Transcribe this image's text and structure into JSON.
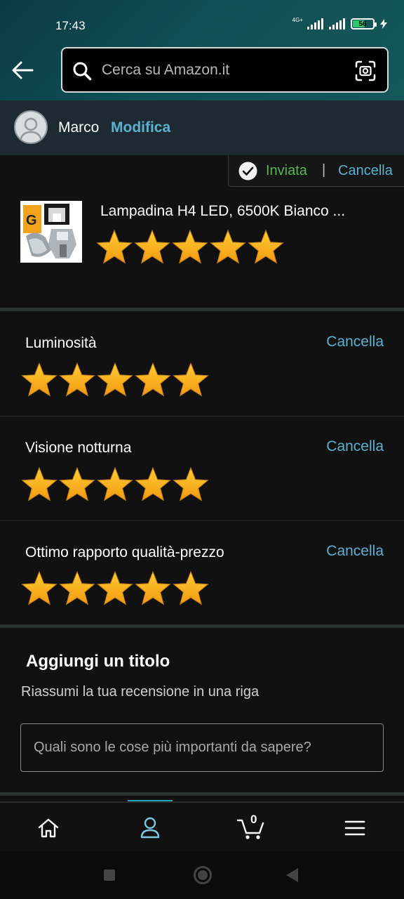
{
  "status_bar": {
    "time": "17:43",
    "network": "4G+",
    "battery": "56",
    "battery_level_pct": 56
  },
  "search": {
    "placeholder": "Cerca su Amazon.it"
  },
  "profile": {
    "name": "Marco",
    "edit_label": "Modifica"
  },
  "submission": {
    "status": "Inviata",
    "separator": "|",
    "cancel_label": "Cancella"
  },
  "product": {
    "title": "Lampadina H4 LED, 6500K Bianco ...",
    "rating": 5,
    "rating_max": 5
  },
  "attributes": [
    {
      "label": "Luminosità",
      "cancel_label": "Cancella",
      "rating": 5
    },
    {
      "label": "Visione notturna",
      "cancel_label": "Cancella",
      "rating": 5
    },
    {
      "label": "Ottimo rapporto qualità-prezzo",
      "cancel_label": "Cancella",
      "rating": 5
    }
  ],
  "review_title": {
    "heading": "Aggiungi un titolo",
    "subheading": "Riassumi la tua recensione in una riga",
    "placeholder": "Quali sono le cose più importanti da sapere?"
  },
  "bottom_nav": {
    "items": [
      "home-icon",
      "user-icon",
      "cart-icon",
      "menu-icon"
    ],
    "active": "user-icon",
    "cart_count": "0"
  },
  "colors": {
    "accent_link": "#5ab1d0",
    "star": "#f6a623",
    "success": "#58b453",
    "nav_indicator": "#25a2bd"
  }
}
